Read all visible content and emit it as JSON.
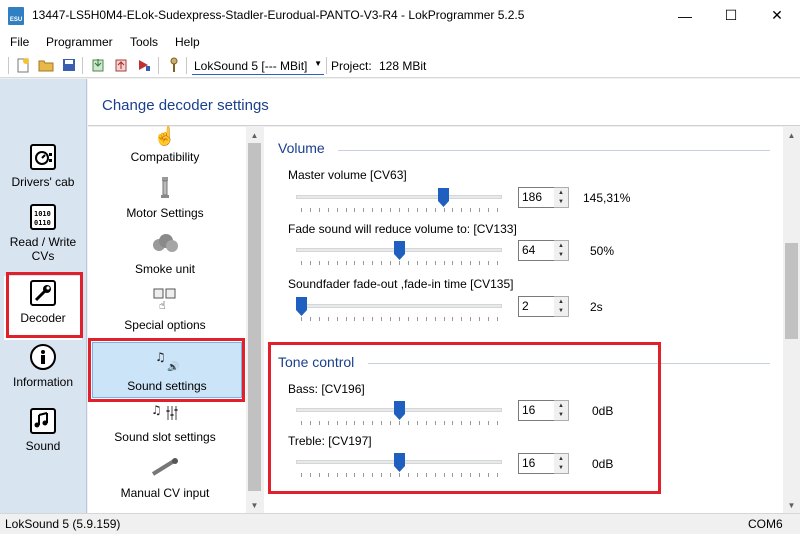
{
  "window": {
    "title": "13447-LS5H0M4-ELok-Sudexpress-Stadler-Eurodual-PANTO-V3-R4 - LokProgrammer 5.2.5",
    "logo_text": "ESU",
    "minimize": "—",
    "maximize": "☐",
    "close": "✕"
  },
  "menu": [
    {
      "label": "File"
    },
    {
      "label": "Programmer"
    },
    {
      "label": "Tools"
    },
    {
      "label": "Help"
    }
  ],
  "toolbar": {
    "decoder_select": "LokSound 5 [--- MBit]",
    "project_label": "Project:",
    "project_value": "128 MBit",
    "icons": [
      "new-icon",
      "open-icon",
      "save-icon",
      "read-icon",
      "write-icon",
      "run-icon",
      "pin-icon"
    ]
  },
  "left_nav": [
    {
      "label": "Drivers' cab",
      "icon": "drivers-cab-icon"
    },
    {
      "label": "Read / Write CVs",
      "icon": "read-write-icon"
    },
    {
      "label": "Decoder",
      "icon": "wrench-icon",
      "active": true
    },
    {
      "label": "Information",
      "icon": "info-icon"
    },
    {
      "label": "Sound",
      "icon": "sound-icon"
    }
  ],
  "header": {
    "title": "Change decoder settings"
  },
  "categories": [
    {
      "label": "Compatibility",
      "icon": "hand-icon"
    },
    {
      "label": "Motor Settings",
      "icon": "motor-icon"
    },
    {
      "label": "Smoke unit",
      "icon": "smoke-icon"
    },
    {
      "label": "Special options",
      "icon": "special-options-icon"
    },
    {
      "label": "Sound settings",
      "icon": "sound-settings-icon",
      "active": true
    },
    {
      "label": "Sound slot settings",
      "icon": "sound-slot-icon"
    },
    {
      "label": "Manual CV input",
      "icon": "manual-cv-icon"
    }
  ],
  "volume": {
    "title": "Volume",
    "controls": [
      {
        "label": "Master volume [CV63]",
        "value": "186",
        "readout": "145,31%",
        "level": 186,
        "max": 255
      },
      {
        "label": "Fade sound will reduce volume to:  [CV133]",
        "value": "64",
        "readout": "50%",
        "level": 64,
        "max": 128
      },
      {
        "label": "Soundfader fade-out ,fade-in time [CV135]",
        "value": "2",
        "readout": "2s",
        "level": 0,
        "max": 255
      }
    ]
  },
  "tone": {
    "title": "Tone control",
    "controls": [
      {
        "label": "Bass: [CV196]",
        "value": "16",
        "readout": "0dB",
        "level": 16,
        "max": 32
      },
      {
        "label": "Treble: [CV197]",
        "value": "16",
        "readout": "0dB",
        "level": 16,
        "max": 32
      }
    ]
  },
  "status": {
    "left": "LokSound 5 (5.9.159)",
    "right": "COM6"
  },
  "colors": {
    "highlight_red": "#e0202a",
    "accent_blue": "#1a3f8f",
    "slider_thumb": "#1f5fbf"
  }
}
